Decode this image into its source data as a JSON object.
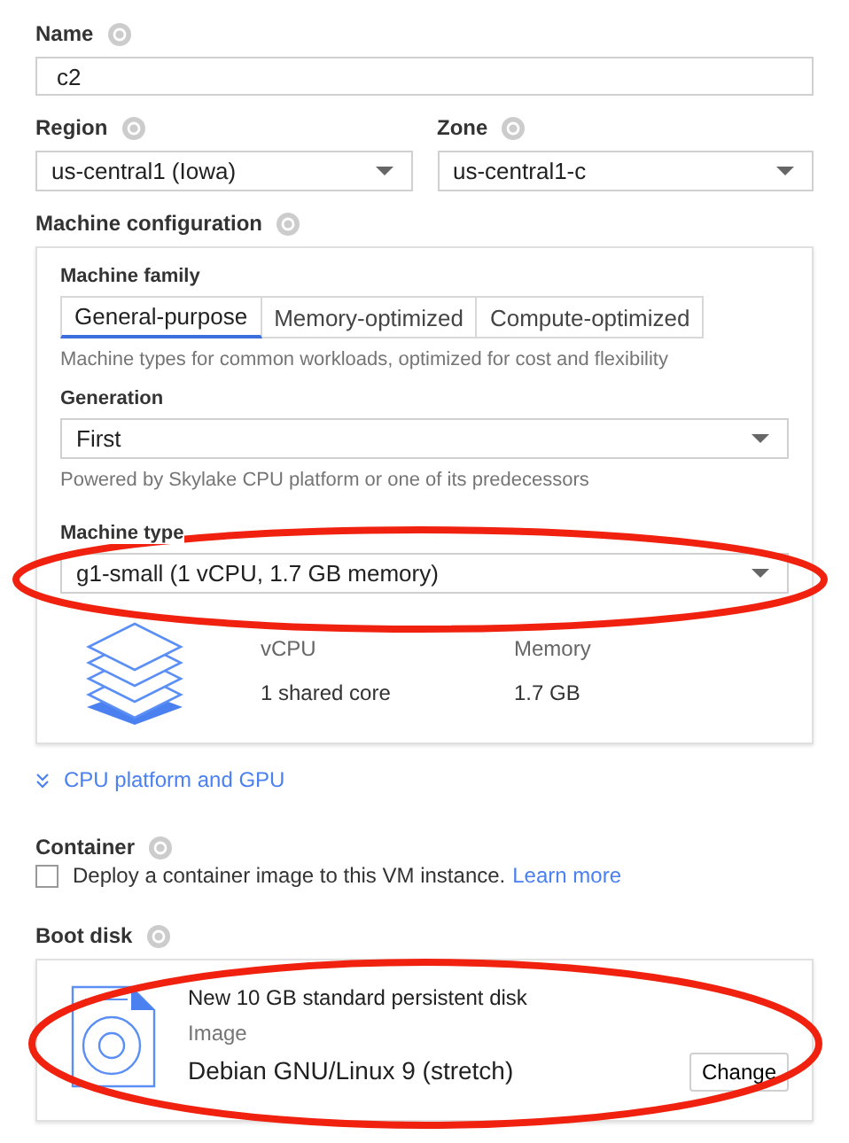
{
  "name": {
    "label": "Name",
    "value": "c2"
  },
  "region": {
    "label": "Region",
    "value": "us-central1 (Iowa)"
  },
  "zone": {
    "label": "Zone",
    "value": "us-central1-c"
  },
  "machine_configuration": {
    "label": "Machine configuration",
    "family_label": "Machine family",
    "tabs": [
      {
        "label": "General-purpose",
        "selected": true
      },
      {
        "label": "Memory-optimized",
        "selected": false
      },
      {
        "label": "Compute-optimized",
        "selected": false
      }
    ],
    "family_description": "Machine types for common workloads, optimized for cost and flexibility",
    "generation": {
      "label": "Generation",
      "value": "First",
      "hint": "Powered by Skylake CPU platform or one of its predecessors"
    },
    "machine_type": {
      "label": "Machine type",
      "value": "g1-small (1 vCPU, 1.7 GB memory)"
    },
    "specs": [
      {
        "label": "vCPU",
        "value": "1 shared core"
      },
      {
        "label": "Memory",
        "value": "1.7 GB"
      }
    ]
  },
  "cpu_link": "CPU platform and GPU",
  "container": {
    "label": "Container",
    "checkbox_label": "Deploy a container image to this VM instance.",
    "link": "Learn more",
    "checked": false
  },
  "boot_disk": {
    "label": "Boot disk",
    "title": "New 10 GB standard persistent disk",
    "image_label": "Image",
    "image": "Debian GNU/Linux 9 (stretch)",
    "button": "Change"
  }
}
